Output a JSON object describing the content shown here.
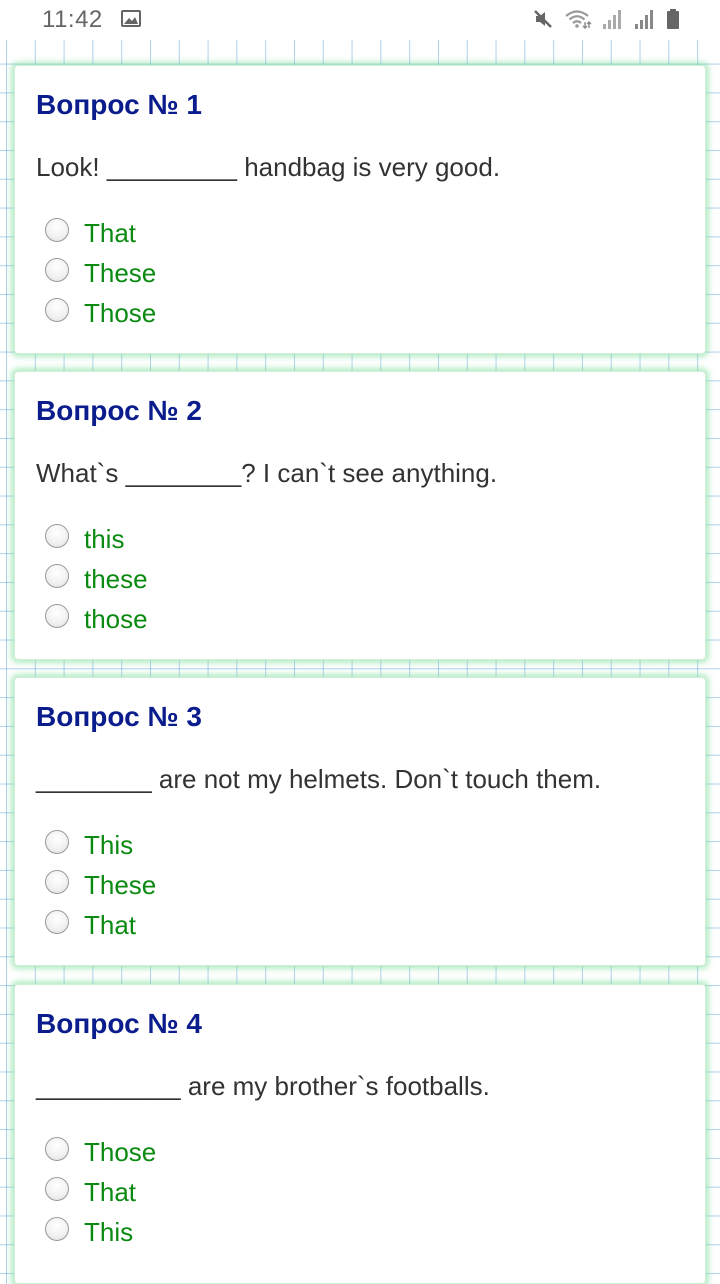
{
  "status_bar": {
    "time": "11:42",
    "icons": [
      "image-icon",
      "mute-icon",
      "wifi-icon",
      "signal-1-icon",
      "signal-2-icon",
      "battery-icon"
    ]
  },
  "colors": {
    "title": "#0b1d8c",
    "option_text": "#0b8a12",
    "question_text": "#333333",
    "card_glow": "#78dc96",
    "grid_lines": "#6eaae1"
  },
  "quiz": {
    "questions": [
      {
        "title": "Вопрос № 1",
        "text": "Look! _________ handbag is very good.",
        "options": [
          "That",
          "These",
          "Those"
        ]
      },
      {
        "title": "Вопрос № 2",
        "text": "What`s ________? I can`t see anything.",
        "options": [
          "this",
          "these",
          "those"
        ]
      },
      {
        "title": "Вопрос № 3",
        "text": "________ are not my helmets. Don`t touch them.",
        "options": [
          "This",
          "These",
          "That"
        ]
      },
      {
        "title": "Вопрос № 4",
        "text": "__________ are my brother`s footballs.",
        "options": [
          "Those",
          "That",
          "This"
        ]
      }
    ]
  }
}
